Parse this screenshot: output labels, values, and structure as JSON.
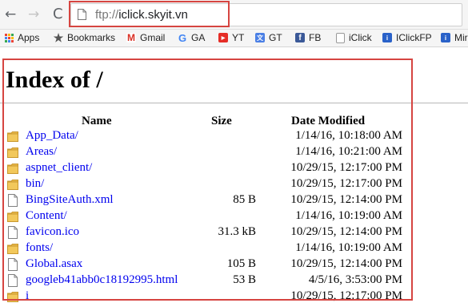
{
  "browser": {
    "back_glyph": "←",
    "forward_glyph": "→",
    "reload_glyph": "C",
    "url_scheme": "ftp://",
    "url_host": "iclick.skyit.vn"
  },
  "bookmarks": [
    {
      "label": "Apps",
      "icon": "apps-icon"
    },
    {
      "label": "Bookmarks",
      "icon": "star-icon"
    },
    {
      "label": "Gmail",
      "icon": "gmail-icon",
      "glyph": "M"
    },
    {
      "label": "GA",
      "icon": "google-icon",
      "glyph": "G"
    },
    {
      "label": "YT",
      "icon": "youtube-icon",
      "glyph": "▶"
    },
    {
      "label": "GT",
      "icon": "translate-icon",
      "glyph": "文"
    },
    {
      "label": "FB",
      "icon": "facebook-icon",
      "glyph": "f"
    },
    {
      "label": "iClick",
      "icon": "page-icon",
      "glyph": ""
    },
    {
      "label": "IClickFP",
      "icon": "iclick-icon",
      "glyph": "i"
    },
    {
      "label": "Mir",
      "icon": "iclick-icon",
      "glyph": "i"
    }
  ],
  "page": {
    "heading": "Index of /",
    "columns": {
      "name": "Name",
      "size": "Size",
      "date": "Date Modified"
    },
    "entries": [
      {
        "name": "App_Data/",
        "type": "folder",
        "size": "",
        "date": "1/14/16, 10:18:00 AM"
      },
      {
        "name": "Areas/",
        "type": "folder",
        "size": "",
        "date": "1/14/16, 10:21:00 AM"
      },
      {
        "name": "aspnet_client/",
        "type": "folder",
        "size": "",
        "date": "10/29/15, 12:17:00 PM"
      },
      {
        "name": "bin/",
        "type": "folder",
        "size": "",
        "date": "10/29/15, 12:17:00 PM"
      },
      {
        "name": "BingSiteAuth.xml",
        "type": "file",
        "size": "85 B",
        "date": "10/29/15, 12:14:00 PM"
      },
      {
        "name": "Content/",
        "type": "folder",
        "size": "",
        "date": "1/14/16, 10:19:00 AM"
      },
      {
        "name": "favicon.ico",
        "type": "file",
        "size": "31.3 kB",
        "date": "10/29/15, 12:14:00 PM"
      },
      {
        "name": "fonts/",
        "type": "folder",
        "size": "",
        "date": "1/14/16, 10:19:00 AM"
      },
      {
        "name": "Global.asax",
        "type": "file",
        "size": "105 B",
        "date": "10/29/15, 12:14:00 PM"
      },
      {
        "name": "googleb41abb0c18192995.html",
        "type": "file",
        "size": "53 B",
        "date": "4/5/16, 3:53:00 PM"
      },
      {
        "name": "i",
        "type": "folder",
        "size": "",
        "date": "10/29/15, 12:17:00 PM"
      }
    ]
  },
  "colors": {
    "highlight": "#d64541",
    "link": "#0000ee",
    "folder": "#e8b84a"
  }
}
